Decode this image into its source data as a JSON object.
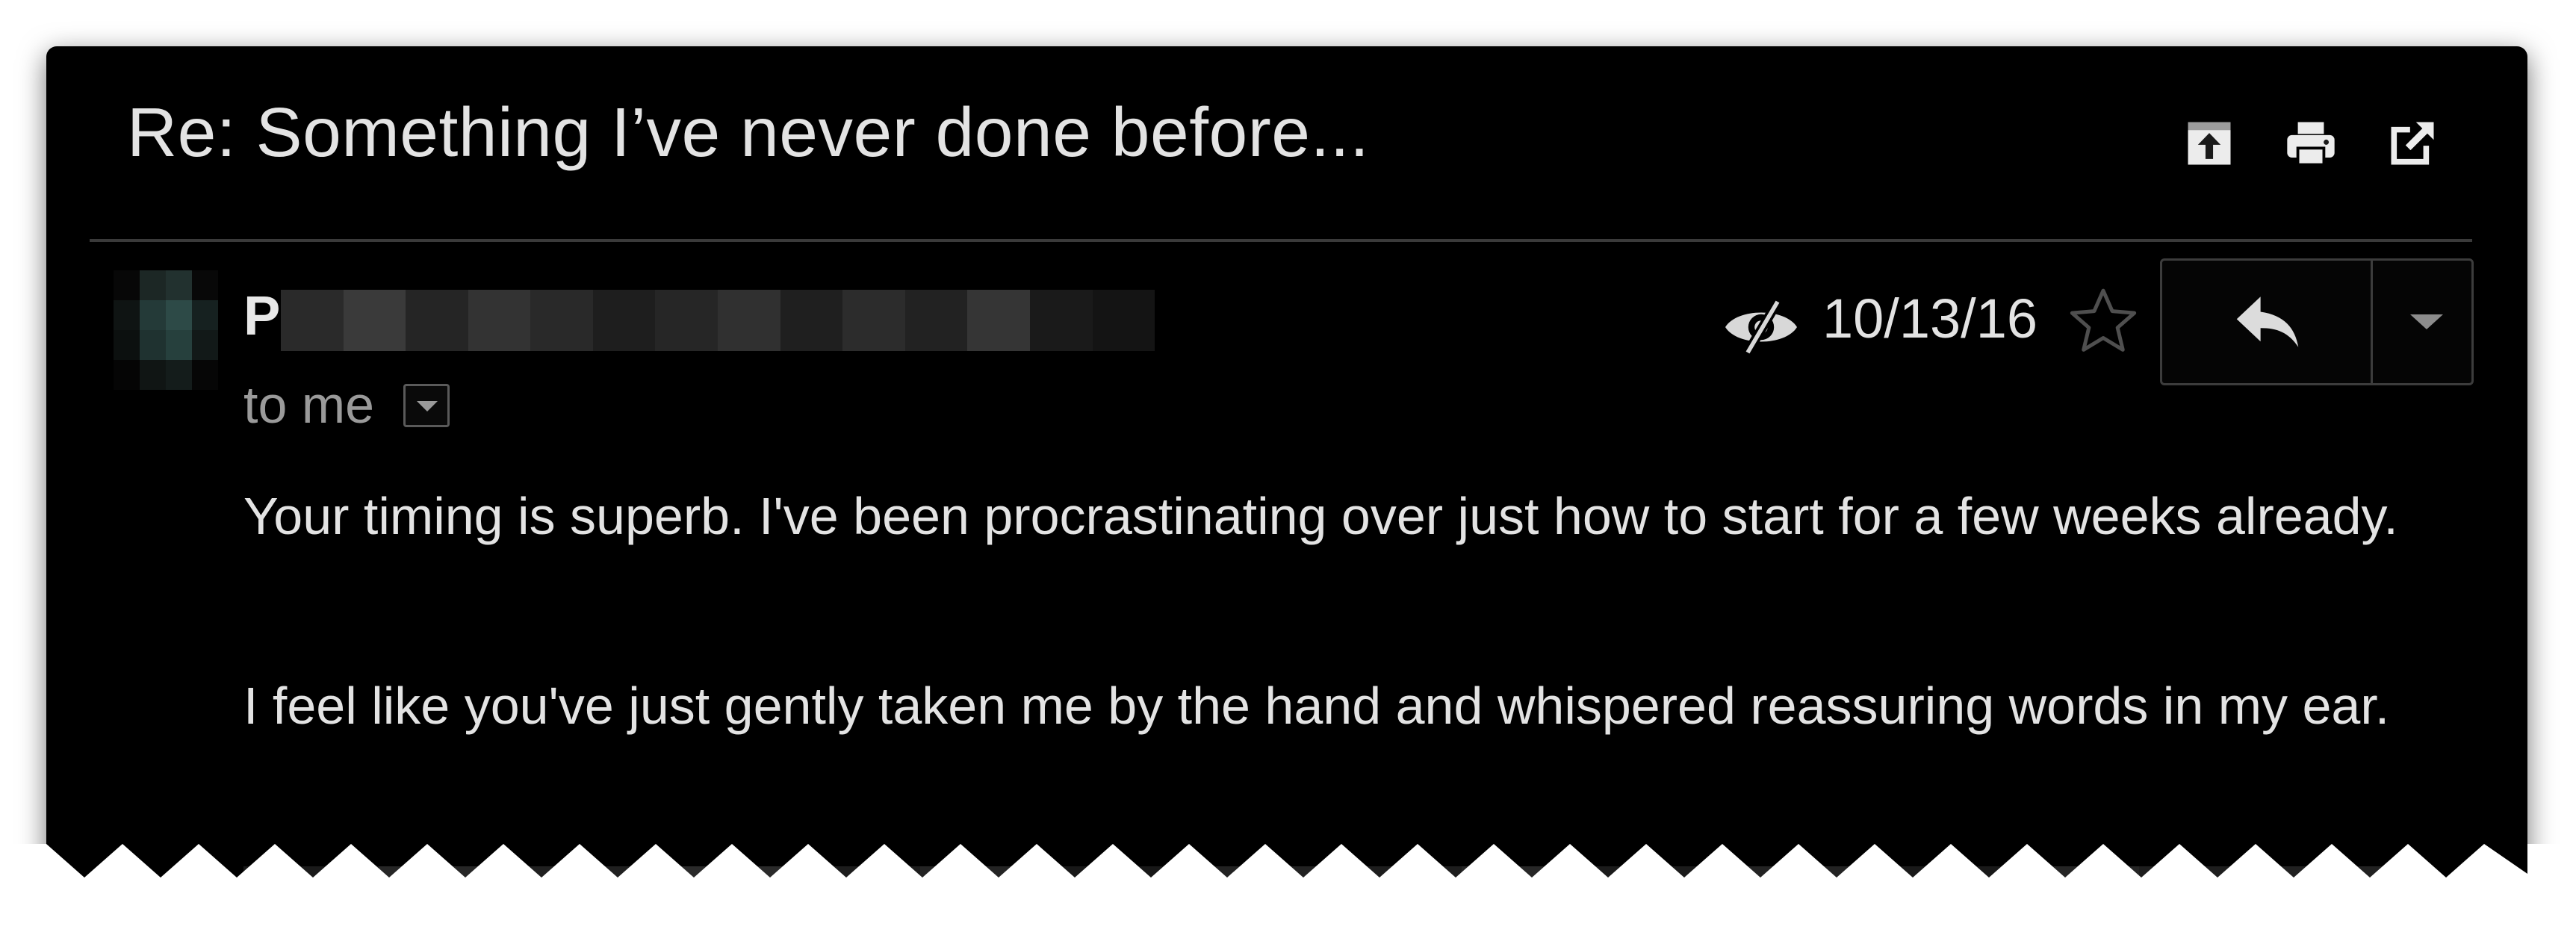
{
  "email": {
    "subject": "Re: Something I’ve never done before...",
    "sender_initial": "P",
    "recipient_line": "to me",
    "date": "10/13/16",
    "body": [
      "Your timing is superb. I've been procrastinating over just how to start for a few weeks already.",
      "I feel like you've just gently taken me by the hand and whispered reassuring words in my ear."
    ]
  },
  "toolbar": {
    "icons": [
      "archive-up-icon",
      "print-icon",
      "open-new-window-icon"
    ]
  },
  "header_icons": {
    "eye": "hidden-eye-icon",
    "star": "star-outline-icon",
    "reply": "reply-arrow-icon",
    "more": "chevron-down-icon",
    "recipients_toggle": "chevron-down-icon"
  },
  "colors": {
    "card_background": "#000000",
    "text_primary": "#e3e3e3",
    "text_secondary": "#9a9a9a",
    "border": "#3c3c3c",
    "divider": "#3a3a3a"
  }
}
